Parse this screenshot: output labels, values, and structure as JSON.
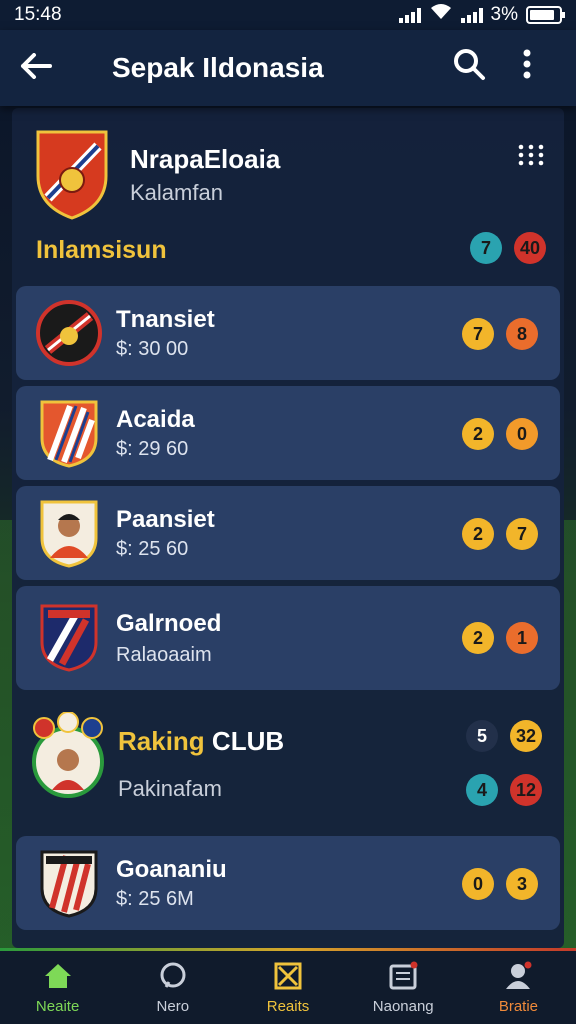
{
  "status": {
    "time": "15:48",
    "battery": "3%"
  },
  "app_bar": {
    "title": "Sepak Ildonasia",
    "back_icon": "arrow-left-icon",
    "search_icon": "search-icon",
    "more_icon": "more-vertical-icon"
  },
  "featured": {
    "name": "NrapaEloaia",
    "subtitle": "Kalamfan",
    "grid_icon": "grid-dots-icon"
  },
  "section": {
    "title": "Inlamsisun",
    "badges": [
      {
        "label": "7",
        "color": "#2aa3b0"
      },
      {
        "label": "40",
        "color": "#d0332b"
      }
    ]
  },
  "cards": [
    {
      "name": "Tnansiet",
      "value": "$: 30 00",
      "badges": [
        {
          "label": "7",
          "color": "#f2b52a"
        },
        {
          "label": "8",
          "color": "#ea6d2c"
        }
      ]
    },
    {
      "name": "Acaida",
      "value": "$: 29 60",
      "badges": [
        {
          "label": "2",
          "color": "#f2b52a"
        },
        {
          "label": "0",
          "color": "#f29a2a"
        }
      ]
    },
    {
      "name": "Paansiet",
      "value": "$: 25 60",
      "badges": [
        {
          "label": "2",
          "color": "#f2b52a"
        },
        {
          "label": "7",
          "color": "#f2b52a"
        }
      ]
    },
    {
      "name": "Galrnoed",
      "value": "Ralaoaaim",
      "badges": [
        {
          "label": "2",
          "color": "#f2b52a"
        },
        {
          "label": "1",
          "color": "#ea6d2c"
        }
      ]
    }
  ],
  "raking": {
    "name_accent": "Raking",
    "name_rest": "CLUB",
    "subtitle": "Pakinafam",
    "badges_top": [
      {
        "label": "5",
        "color": "#22304a"
      },
      {
        "label": "32",
        "color": "#f2b52a"
      }
    ],
    "badges_bottom": [
      {
        "label": "4",
        "color": "#2aa3b0"
      },
      {
        "label": "12",
        "color": "#d0332b"
      }
    ]
  },
  "card_last": {
    "name": "Goananiu",
    "value": "$: 25 6M",
    "badges": [
      {
        "label": "0",
        "color": "#f2b52a"
      },
      {
        "label": "3",
        "color": "#f2b52a"
      }
    ]
  },
  "nav": [
    {
      "label": "Neaite",
      "icon": "home-icon"
    },
    {
      "label": "Nero",
      "icon": "chat-icon"
    },
    {
      "label": "Reaits",
      "icon": "results-icon"
    },
    {
      "label": "Naonang",
      "icon": "inbox-icon"
    },
    {
      "label": "Bratie",
      "icon": "profile-icon"
    }
  ]
}
